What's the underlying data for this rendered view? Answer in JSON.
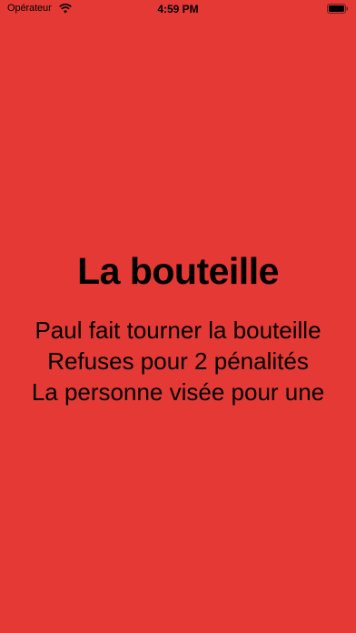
{
  "status_bar": {
    "carrier": "Opérateur",
    "wifi_icon": "wifi-icon",
    "time": "4:59 PM",
    "battery_icon": "battery-icon"
  },
  "colors": {
    "background": "#E53935",
    "text": "#000000"
  },
  "game": {
    "title": "La bouteille",
    "lines": [
      "Paul fait tourner la bouteille",
      "Refuses pour 2 pénalités",
      "La personne visée pour une"
    ]
  }
}
